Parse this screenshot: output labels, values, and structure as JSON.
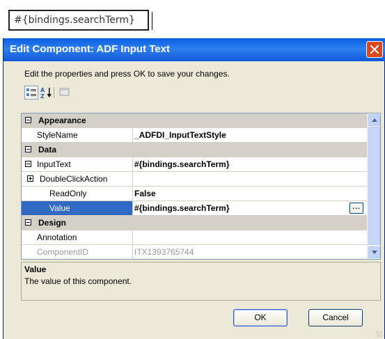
{
  "top_cell": {
    "text": "#{bindings.searchTerm}"
  },
  "dialog": {
    "title": "Edit Component: ADF Input Text",
    "instructions": "Edit the properties and press OK to save your changes.",
    "toolbar": {
      "categorized_icon": "categorized-icon",
      "alphabetical_icon": "sort-az-icon",
      "pages_icon": "property-pages-icon"
    },
    "grid": {
      "rows": [
        {
          "type": "category",
          "label": "Appearance"
        },
        {
          "type": "prop",
          "key": "StyleName",
          "value": "_ADFDI_InputTextStyle"
        },
        {
          "type": "category",
          "label": "Data"
        },
        {
          "type": "prop",
          "key": "InputText",
          "value": "#{bindings.searchTerm}"
        },
        {
          "type": "prop",
          "key": "DoubleClickAction",
          "value": ""
        },
        {
          "type": "prop",
          "key": "ReadOnly",
          "value": "False"
        },
        {
          "type": "prop",
          "key": "Value",
          "value": "#{bindings.searchTerm}",
          "selected": true
        },
        {
          "type": "category",
          "label": "Design"
        },
        {
          "type": "prop",
          "key": "Annotation",
          "value": ""
        },
        {
          "type": "prop",
          "key": "ComponentID",
          "value": "ITX1393765744",
          "disabled": true
        }
      ],
      "ellipsis": "..."
    },
    "description": {
      "title": "Value",
      "text": "The value of this component."
    },
    "buttons": {
      "ok": "OK",
      "cancel": "Cancel"
    }
  }
}
